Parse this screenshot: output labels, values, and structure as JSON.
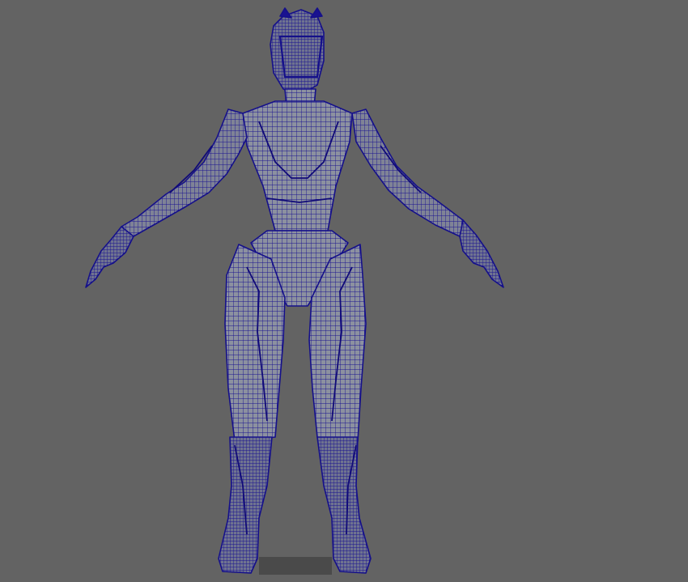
{
  "viewport": {
    "background_color": "#636363",
    "mesh_fill_color": "#8a8f9c",
    "wireframe_color": "#16108c",
    "ground_color": "#4a4a4a",
    "model": {
      "subject": "humanoid-armored-character",
      "pose": "a-pose",
      "display_mode": "wireframe-on-shaded"
    }
  }
}
